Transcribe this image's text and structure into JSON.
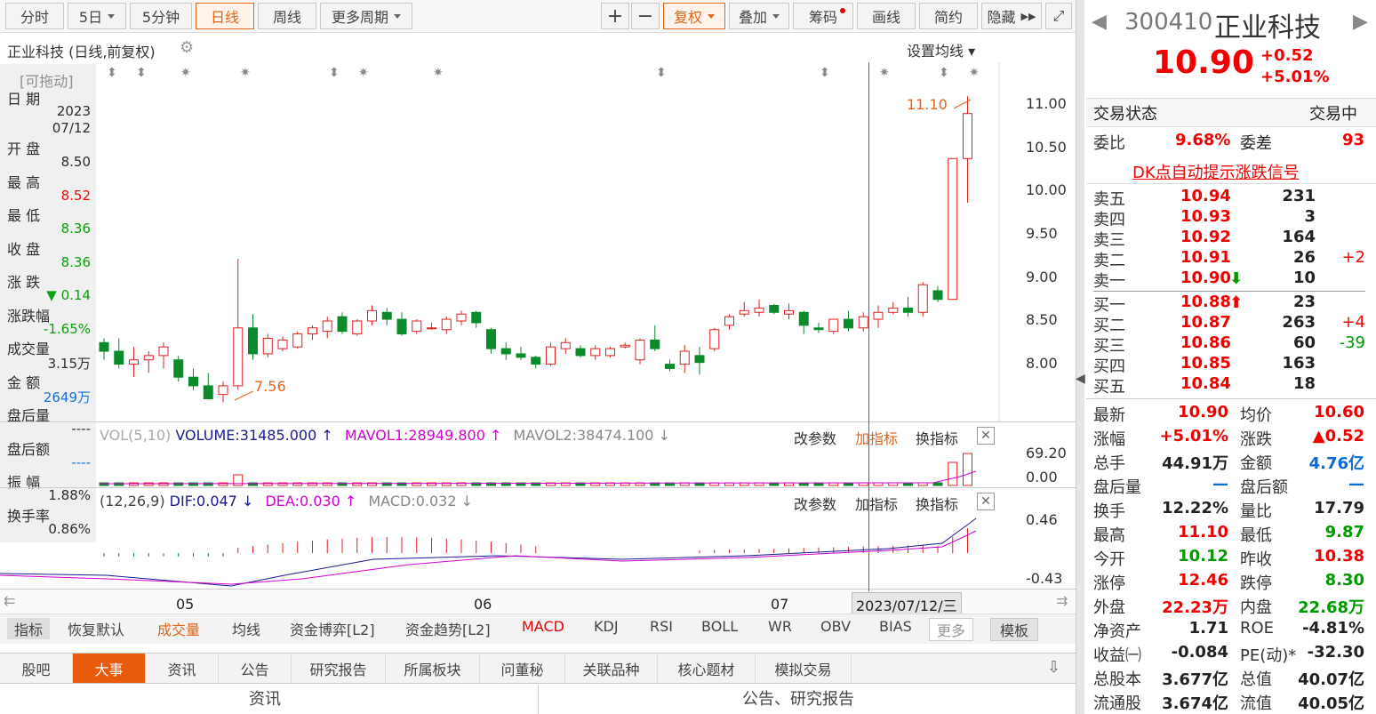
{
  "toolbar": {
    "periods": [
      "分时",
      "5日",
      "5分钟",
      "日线",
      "周线",
      "更多周期"
    ],
    "right": [
      "+",
      "−",
      "复权",
      "叠加",
      "筹码",
      "画线",
      "简约",
      "隐藏"
    ]
  },
  "chart": {
    "title": "正业科技 (日线,前复权)",
    "ma_setting": "设置均线",
    "draggable": "[可拖动]",
    "hi_label": "11.10",
    "lo_label": "7.56",
    "y_ticks": [
      "11.00",
      "10.50",
      "10.00",
      "9.50",
      "9.00",
      "8.50",
      "8.00"
    ]
  },
  "info": {
    "date_label": "日 期",
    "date_year": "2023",
    "date_md": "07/12",
    "open_label": "开 盘",
    "open": "8.50",
    "high_label": "最 高",
    "high": "8.52",
    "low_label": "最 低",
    "low": "8.36",
    "close_label": "收 盘",
    "close": "8.36",
    "chg_label": "涨 跌",
    "chg": "▼ 0.14",
    "chgp_label": "涨跌幅",
    "chgp": "-1.65%",
    "vol_label": "成交量",
    "vol": "3.15万",
    "amt_label": "金 额",
    "amt": "2649万",
    "after_label": "盘后量",
    "after": "----",
    "afteramt_label": "盘后额",
    "afteramt": "----",
    "amp_label": "振 幅",
    "amp": "1.88%",
    "turn_label": "换手率",
    "turn": "0.86%"
  },
  "volume": {
    "name": "VOL(5,10)",
    "vol": "VOLUME:31485.000",
    "mavol1": "MAVOL1:28949.800",
    "mavol2": "MAVOL2:38474.100",
    "ticks": [
      "69.20",
      "0.00"
    ]
  },
  "macd": {
    "name": "(12,26,9)",
    "dif": "DIF:0.047",
    "dea": "DEA:0.030",
    "macd": "MACD:0.032",
    "ticks": [
      "0.46",
      "-0.43"
    ]
  },
  "panel_btns": {
    "param": "改参数",
    "add": "加指标",
    "swap": "换指标"
  },
  "xaxis": {
    "labels": [
      "05",
      "06",
      "07"
    ],
    "cursor": "2023/07/12/三"
  },
  "ind_tabs": [
    "指标",
    "恢复默认",
    "成交量",
    "均线",
    "资金博弈[L2]",
    "资金趋势[L2]",
    "MACD",
    "KDJ",
    "RSI",
    "BOLL",
    "WR",
    "OBV",
    "BIAS",
    "更多",
    "模板"
  ],
  "bottom_tabs": [
    "股吧",
    "大事",
    "资讯",
    "公告",
    "研究报告",
    "所属板块",
    "问董秘",
    "关联品种",
    "核心题材",
    "模拟交易"
  ],
  "bottom_sections": [
    "资讯",
    "公告、研究报告"
  ],
  "stock": {
    "code": "300410",
    "name": "正业科技",
    "price": "10.90",
    "chg": "+0.52",
    "chgp": "+5.01%",
    "status_label": "交易状态",
    "status": "交易中",
    "wb_label": "委比",
    "wb": "9.68%",
    "wc_label": "委差",
    "wc": "93",
    "dk": "DK点自动提示涨跌信号"
  },
  "asks": [
    {
      "l": "卖五",
      "p": "10.94",
      "v": "231",
      "d": ""
    },
    {
      "l": "卖四",
      "p": "10.93",
      "v": "3",
      "d": ""
    },
    {
      "l": "卖三",
      "p": "10.92",
      "v": "164",
      "d": ""
    },
    {
      "l": "卖二",
      "p": "10.91",
      "v": "26",
      "d": "+2"
    },
    {
      "l": "卖一",
      "p": "10.90",
      "v": "10",
      "d": ""
    }
  ],
  "bids": [
    {
      "l": "买一",
      "p": "10.88",
      "v": "23",
      "d": ""
    },
    {
      "l": "买二",
      "p": "10.87",
      "v": "263",
      "d": "+4"
    },
    {
      "l": "买三",
      "p": "10.86",
      "v": "60",
      "d": "-39"
    },
    {
      "l": "买四",
      "p": "10.85",
      "v": "163",
      "d": ""
    },
    {
      "l": "买五",
      "p": "10.84",
      "v": "18",
      "d": ""
    }
  ],
  "stats": [
    [
      "最新",
      "10.90",
      "均价",
      "10.60"
    ],
    [
      "涨幅",
      "+5.01%",
      "涨跌",
      "▲0.52"
    ],
    [
      "总手",
      "44.91万",
      "金额",
      "4.76亿"
    ],
    [
      "盘后量",
      "—",
      "盘后额",
      "—"
    ],
    [
      "换手",
      "12.22%",
      "量比",
      "17.79"
    ],
    [
      "最高",
      "11.10",
      "最低",
      "9.87"
    ],
    [
      "今开",
      "10.12",
      "昨收",
      "10.38"
    ],
    [
      "涨停",
      "12.46",
      "跌停",
      "8.30"
    ],
    [
      "外盘",
      "22.23万",
      "内盘",
      "22.68万"
    ],
    [
      "净资产",
      "1.71",
      "ROE",
      "-4.81%"
    ],
    [
      "收益㈠",
      "-0.084",
      "PE(动)*",
      "-32.30"
    ],
    [
      "总股本",
      "3.677亿",
      "总值",
      "40.07亿"
    ],
    [
      "流通股",
      "3.674亿",
      "流值",
      "40.05亿"
    ]
  ],
  "chart_data": {
    "type": "candlestick",
    "candles": [
      [
        8.25,
        8.3,
        8.05,
        8.15
      ],
      [
        8.15,
        8.3,
        7.95,
        8.0
      ],
      [
        8.0,
        8.2,
        7.85,
        8.05
      ],
      [
        8.05,
        8.15,
        7.9,
        8.1
      ],
      [
        8.1,
        8.25,
        7.95,
        8.2
      ],
      [
        8.05,
        8.1,
        7.8,
        7.85
      ],
      [
        7.85,
        7.95,
        7.7,
        7.75
      ],
      [
        7.75,
        7.9,
        7.6,
        7.6
      ],
      [
        7.65,
        7.8,
        7.56,
        7.75
      ],
      [
        7.75,
        9.22,
        7.7,
        8.42
      ],
      [
        8.42,
        8.58,
        8.05,
        8.12
      ],
      [
        8.12,
        8.35,
        8.08,
        8.3
      ],
      [
        8.18,
        8.32,
        8.15,
        8.28
      ],
      [
        8.2,
        8.38,
        8.18,
        8.35
      ],
      [
        8.35,
        8.45,
        8.28,
        8.42
      ],
      [
        8.38,
        8.55,
        8.3,
        8.5
      ],
      [
        8.55,
        8.6,
        8.35,
        8.38
      ],
      [
        8.35,
        8.52,
        8.33,
        8.5
      ],
      [
        8.5,
        8.68,
        8.45,
        8.62
      ],
      [
        8.6,
        8.65,
        8.45,
        8.52
      ],
      [
        8.52,
        8.6,
        8.33,
        8.35
      ],
      [
        8.38,
        8.52,
        8.35,
        8.5
      ],
      [
        8.42,
        8.48,
        8.4,
        8.42
      ],
      [
        8.4,
        8.55,
        8.35,
        8.52
      ],
      [
        8.5,
        8.62,
        8.45,
        8.58
      ],
      [
        8.6,
        8.62,
        8.42,
        8.48
      ],
      [
        8.4,
        8.42,
        8.12,
        8.18
      ],
      [
        8.18,
        8.25,
        8.05,
        8.12
      ],
      [
        8.12,
        8.2,
        8.05,
        8.08
      ],
      [
        8.08,
        8.1,
        7.95,
        8.0
      ],
      [
        8.0,
        8.25,
        7.98,
        8.2
      ],
      [
        8.18,
        8.3,
        8.12,
        8.25
      ],
      [
        8.18,
        8.22,
        8.08,
        8.1
      ],
      [
        8.1,
        8.22,
        8.05,
        8.18
      ],
      [
        8.1,
        8.2,
        8.08,
        8.18
      ],
      [
        8.2,
        8.25,
        8.18,
        8.22
      ],
      [
        8.05,
        8.3,
        8.0,
        8.28
      ],
      [
        8.28,
        8.45,
        8.15,
        8.18
      ],
      [
        8.0,
        8.05,
        7.92,
        7.95
      ],
      [
        8.0,
        8.22,
        7.9,
        8.15
      ],
      [
        8.1,
        8.2,
        7.88,
        8.02
      ],
      [
        8.18,
        8.42,
        8.15,
        8.4
      ],
      [
        8.45,
        8.58,
        8.4,
        8.55
      ],
      [
        8.58,
        8.72,
        8.55,
        8.62
      ],
      [
        8.6,
        8.75,
        8.55,
        8.65
      ],
      [
        8.68,
        8.7,
        8.58,
        8.6
      ],
      [
        8.58,
        8.7,
        8.52,
        8.62
      ],
      [
        8.6,
        8.62,
        8.35,
        8.45
      ],
      [
        8.42,
        8.48,
        8.36,
        8.4
      ],
      [
        8.38,
        8.5,
        8.35,
        8.52
      ],
      [
        8.52,
        8.62,
        8.38,
        8.42
      ],
      [
        8.42,
        8.6,
        8.38,
        8.55
      ],
      [
        8.52,
        8.68,
        8.42,
        8.6
      ],
      [
        8.6,
        8.72,
        8.58,
        8.65
      ],
      [
        8.65,
        8.78,
        8.55,
        8.6
      ],
      [
        8.6,
        8.95,
        8.55,
        8.92
      ],
      [
        8.85,
        8.9,
        8.72,
        8.75
      ],
      [
        8.75,
        10.38,
        8.75,
        10.38
      ],
      [
        10.38,
        11.1,
        9.87,
        10.9
      ]
    ]
  }
}
